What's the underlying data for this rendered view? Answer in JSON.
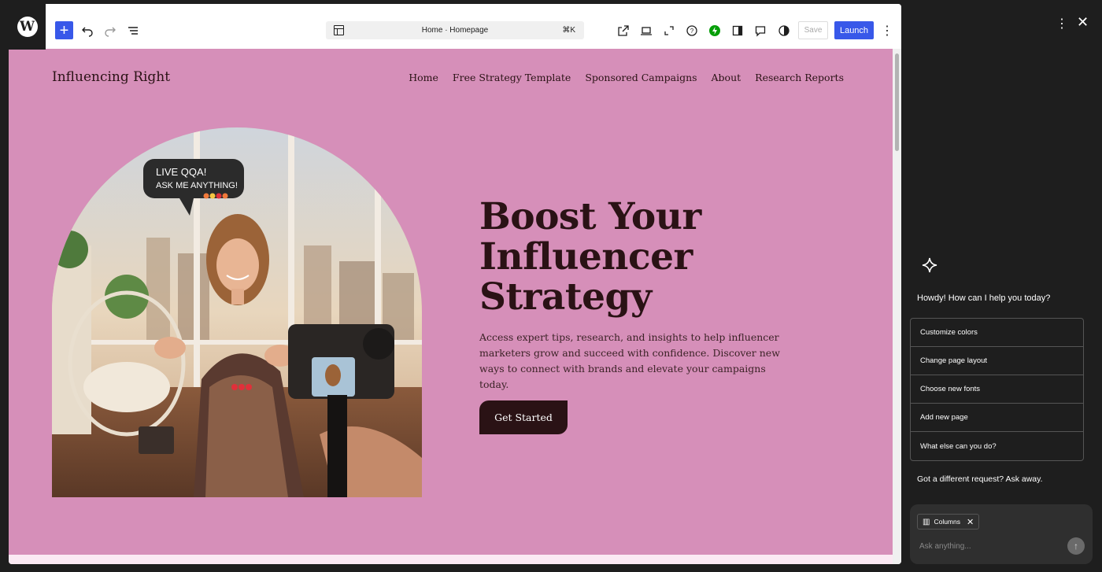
{
  "toolbar": {
    "logo_glyph": "W",
    "add_icon": "plus-icon",
    "command_title": "Home · Homepage",
    "command_shortcut": "⌘K",
    "save_label": "Save",
    "launch_label": "Launch",
    "accent": "#3858e9"
  },
  "site": {
    "title": "Influencing Right",
    "nav": [
      "Home",
      "Free Strategy Template",
      "Sponsored Campaigns",
      "About",
      "Research Reports"
    ],
    "bubble_line1": "LIVE QQA!",
    "bubble_line2": "ASK ME ANYTHING!",
    "headline": [
      "Boost Your",
      "Influencer",
      "Strategy"
    ],
    "lead": "Access expert tips, research, and insights to help influencer marketers grow and succeed with confidence. Discover new ways to connect with brands and elevate your campaigns today.",
    "cta_label": "Get Started",
    "bg": "#d68fb9"
  },
  "assistant": {
    "greeting": "Howdy! How can I help you today?",
    "suggestions": [
      "Customize colors",
      "Change page layout",
      "Choose new fonts",
      "Add new page",
      "What else can you do?"
    ],
    "other_request": "Got a different request? Ask away.",
    "chip_label": "Columns",
    "input_placeholder": "Ask anything..."
  }
}
